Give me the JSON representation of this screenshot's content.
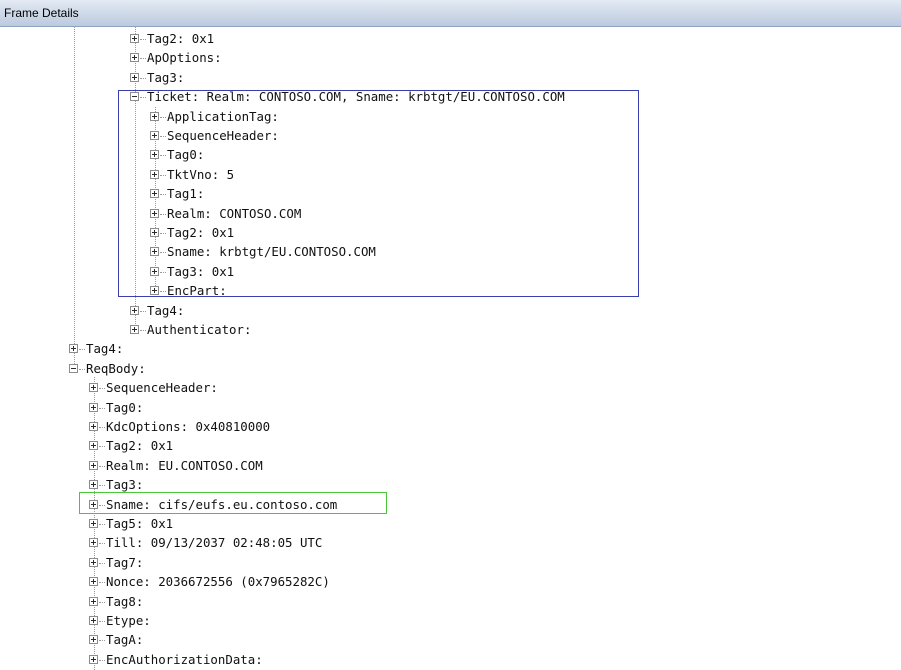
{
  "panel": {
    "title": "Frame Details"
  },
  "tree": [
    {
      "label": "Tag2: 0x1",
      "indent": 2,
      "expanded": false
    },
    {
      "label": "ApOptions:",
      "indent": 2,
      "expanded": false
    },
    {
      "label": "Tag3:",
      "indent": 2,
      "expanded": false
    },
    {
      "label": "Ticket: Realm: CONTOSO.COM, Sname: krbtgt/EU.CONTOSO.COM",
      "indent": 2,
      "expanded": true,
      "highlight": "blue"
    },
    {
      "label": "ApplicationTag:",
      "indent": 3,
      "expanded": false
    },
    {
      "label": "SequenceHeader:",
      "indent": 3,
      "expanded": false
    },
    {
      "label": "Tag0:",
      "indent": 3,
      "expanded": false
    },
    {
      "label": "TktVno: 5",
      "indent": 3,
      "expanded": false
    },
    {
      "label": "Tag1:",
      "indent": 3,
      "expanded": false
    },
    {
      "label": "Realm: CONTOSO.COM",
      "indent": 3,
      "expanded": false
    },
    {
      "label": "Tag2: 0x1",
      "indent": 3,
      "expanded": false
    },
    {
      "label": "Sname: krbtgt/EU.CONTOSO.COM",
      "indent": 3,
      "expanded": false
    },
    {
      "label": "Tag3: 0x1",
      "indent": 3,
      "expanded": false
    },
    {
      "label": "EncPart:",
      "indent": 3,
      "expanded": false
    },
    {
      "label": "Tag4:",
      "indent": 2,
      "expanded": false
    },
    {
      "label": "Authenticator:",
      "indent": 2,
      "expanded": false
    },
    {
      "label": "Tag4:",
      "indent": 0,
      "expanded": false
    },
    {
      "label": "ReqBody:",
      "indent": 0,
      "expanded": true
    },
    {
      "label": "SequenceHeader:",
      "indent": 1,
      "expanded": false
    },
    {
      "label": "Tag0:",
      "indent": 1,
      "expanded": false
    },
    {
      "label": "KdcOptions: 0x40810000",
      "indent": 1,
      "expanded": false
    },
    {
      "label": "Tag2: 0x1",
      "indent": 1,
      "expanded": false
    },
    {
      "label": "Realm: EU.CONTOSO.COM",
      "indent": 1,
      "expanded": false
    },
    {
      "label": "Tag3:",
      "indent": 1,
      "expanded": false
    },
    {
      "label": "Sname: cifs/eufs.eu.contoso.com",
      "indent": 1,
      "expanded": false,
      "highlight": "green"
    },
    {
      "label": "Tag5: 0x1",
      "indent": 1,
      "expanded": false
    },
    {
      "label": "Till: 09/13/2037 02:48:05 UTC",
      "indent": 1,
      "expanded": false
    },
    {
      "label": "Tag7:",
      "indent": 1,
      "expanded": false
    },
    {
      "label": "Nonce: 2036672556 (0x7965282C)",
      "indent": 1,
      "expanded": false
    },
    {
      "label": "Tag8:",
      "indent": 1,
      "expanded": false
    },
    {
      "label": "Etype:",
      "indent": 1,
      "expanded": false
    },
    {
      "label": "TagA:",
      "indent": 1,
      "expanded": false
    },
    {
      "label": "EncAuthorizationData:",
      "indent": 1,
      "expanded": false
    }
  ],
  "colors": {
    "highlight_blue": "#3a3fb0",
    "highlight_green": "#46c83a"
  }
}
